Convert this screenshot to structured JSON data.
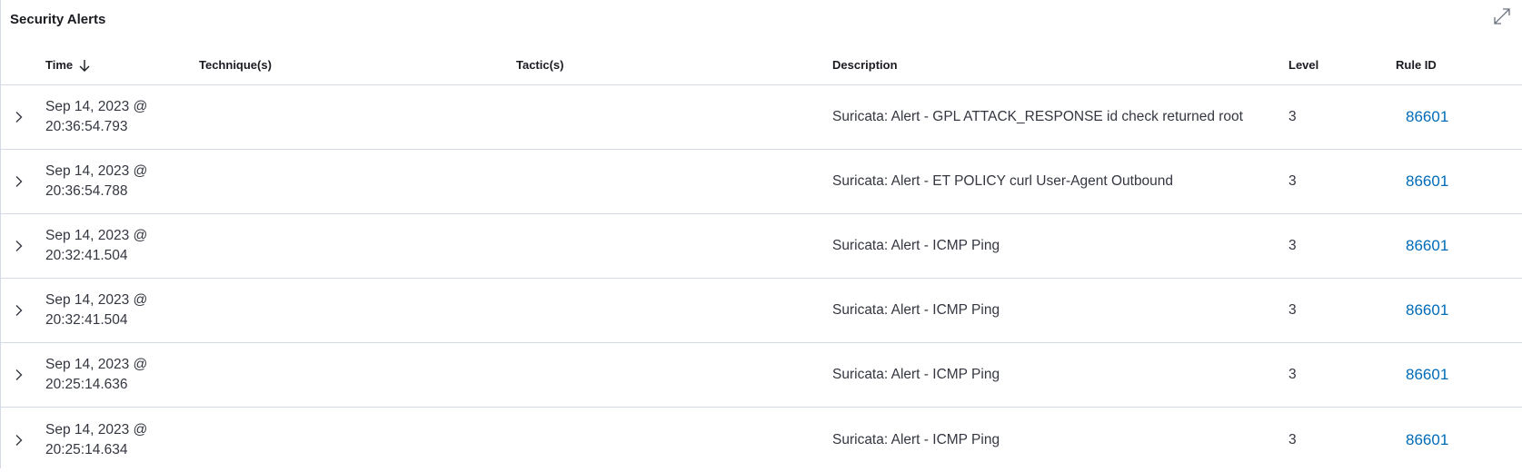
{
  "panel": {
    "title": "Security Alerts"
  },
  "table": {
    "columns": {
      "time": "Time",
      "techniques": "Technique(s)",
      "tactics": "Tactic(s)",
      "description": "Description",
      "level": "Level",
      "rule_id": "Rule ID"
    },
    "sort": {
      "column": "time",
      "direction": "desc"
    },
    "rows": [
      {
        "date": "Sep 14, 2023 @",
        "time": "20:36:54.793",
        "techniques": "",
        "tactics": "",
        "description": "Suricata: Alert - GPL ATTACK_RESPONSE id check returned root",
        "level": "3",
        "rule_id": "86601"
      },
      {
        "date": "Sep 14, 2023 @",
        "time": "20:36:54.788",
        "techniques": "",
        "tactics": "",
        "description": "Suricata: Alert - ET POLICY curl User-Agent Outbound",
        "level": "3",
        "rule_id": "86601"
      },
      {
        "date": "Sep 14, 2023 @",
        "time": "20:32:41.504",
        "techniques": "",
        "tactics": "",
        "description": "Suricata: Alert - ICMP Ping",
        "level": "3",
        "rule_id": "86601"
      },
      {
        "date": "Sep 14, 2023 @",
        "time": "20:32:41.504",
        "techniques": "",
        "tactics": "",
        "description": "Suricata: Alert - ICMP Ping",
        "level": "3",
        "rule_id": "86601"
      },
      {
        "date": "Sep 14, 2023 @",
        "time": "20:25:14.636",
        "techniques": "",
        "tactics": "",
        "description": "Suricata: Alert - ICMP Ping",
        "level": "3",
        "rule_id": "86601"
      },
      {
        "date": "Sep 14, 2023 @",
        "time": "20:25:14.634",
        "techniques": "",
        "tactics": "",
        "description": "Suricata: Alert - ICMP Ping",
        "level": "3",
        "rule_id": "86601"
      }
    ]
  },
  "icons": {
    "expand_panel": "fullscreen-expand-icon",
    "sort": "arrow-down-icon",
    "row_toggle": "chevron-right-icon"
  },
  "colors": {
    "link": "#006bb8",
    "border": "#d3dae6",
    "text": "#343741",
    "heading": "#1a1c21"
  }
}
